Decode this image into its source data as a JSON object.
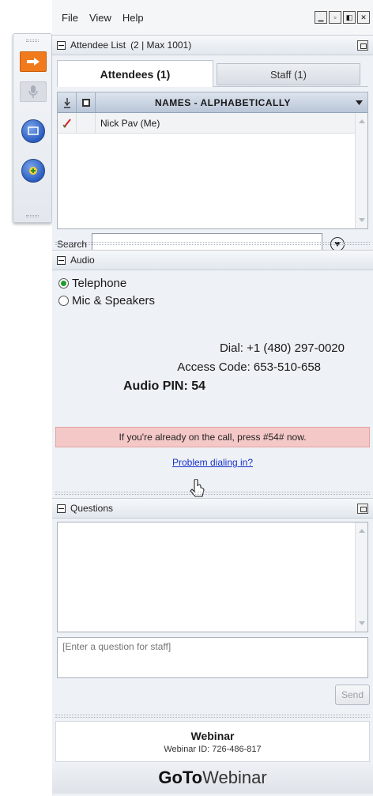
{
  "menu": {
    "file": "File",
    "view": "View",
    "help": "Help"
  },
  "window_buttons": [
    "minimize",
    "restore",
    "maximize",
    "close"
  ],
  "toolbar": {
    "icons": [
      "arrow-icon",
      "mic-icon",
      "screen-icon",
      "webcam-icon"
    ]
  },
  "attendee_section": {
    "title": "Attendee List",
    "count_label": "(2 | Max 1001)",
    "tabs": [
      {
        "label": "Attendees (1)",
        "active": true
      },
      {
        "label": "Staff (1)",
        "active": false
      }
    ],
    "grid": {
      "sort_header": "NAMES - ALPHABETICALLY",
      "rows": [
        {
          "name": "Nick Pav (Me)"
        }
      ]
    },
    "search_label": "Search",
    "search_value": ""
  },
  "audio_section": {
    "title": "Audio",
    "options": [
      {
        "label": "Telephone",
        "selected": true
      },
      {
        "label": "Mic & Speakers",
        "selected": false
      }
    ],
    "dial": "Dial: +1 (480) 297-0020",
    "access_code": "Access Code: 653-510-658",
    "audio_pin": "Audio PIN: 54",
    "alert": "If you're already on the call, press #54# now.",
    "problem_link": "Problem dialing in?"
  },
  "questions_section": {
    "title": "Questions",
    "input_placeholder": "[Enter a question for staff]",
    "send_label": "Send"
  },
  "footer": {
    "title": "Webinar",
    "webinar_id": "Webinar ID: 726-486-817",
    "brand_bold": "GoTo",
    "brand_rest": "Webinar"
  },
  "colors": {
    "accent_orange": "#f07a1c",
    "alert_bg": "#f5c8c8",
    "link": "#1a33cc",
    "radio_on": "#1f9c2b"
  }
}
